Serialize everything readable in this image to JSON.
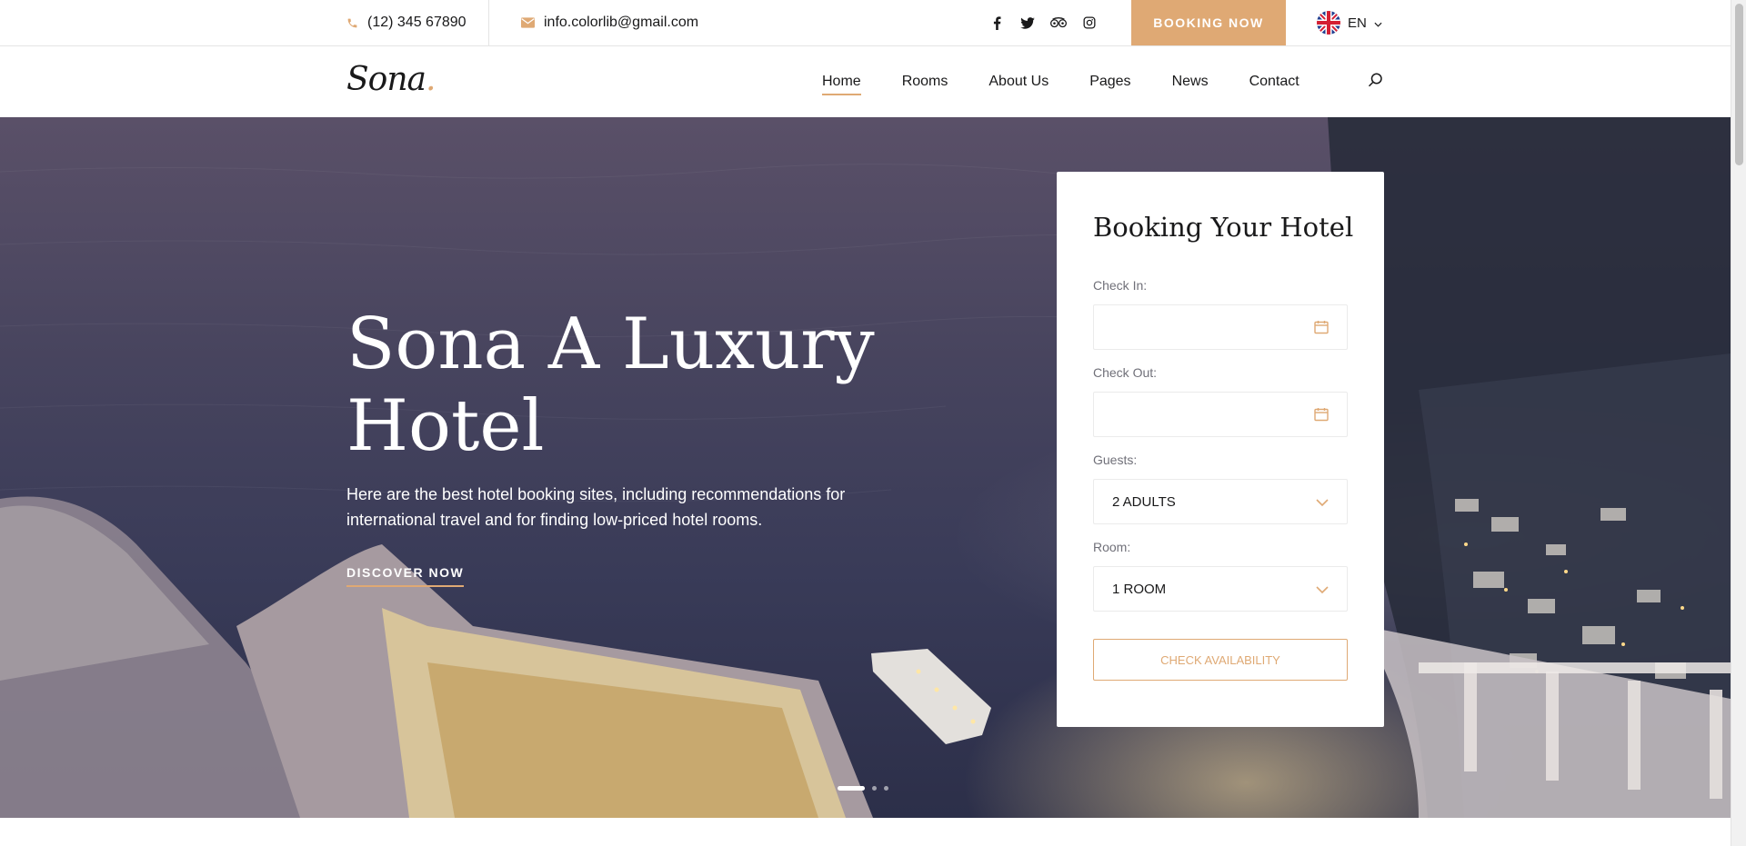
{
  "topbar": {
    "phone": "(12) 345 67890",
    "email": "info.colorlib@gmail.com",
    "social_icons": [
      "facebook-icon",
      "twitter-icon",
      "tripadvisor-icon",
      "instagram-icon"
    ],
    "booking_button": "Booking Now",
    "language": "EN"
  },
  "header": {
    "logo_text": "Sona",
    "logo_dot": ".",
    "nav": [
      {
        "label": "Home",
        "active": true
      },
      {
        "label": "Rooms"
      },
      {
        "label": "About Us"
      },
      {
        "label": "Pages"
      },
      {
        "label": "News"
      },
      {
        "label": "Contact"
      }
    ]
  },
  "hero": {
    "title": "Sona A Luxury Hotel",
    "text": "Here are the best hotel booking sites, including recommendations for international travel and for finding low-priced hotel rooms.",
    "cta": "Discover Now",
    "slides": 3,
    "active_slide": 1
  },
  "booking": {
    "title": "Booking Your Hotel",
    "check_in_label": "Check In:",
    "check_in_value": "",
    "check_out_label": "Check Out:",
    "check_out_value": "",
    "guests_label": "Guests:",
    "guests_value": "2 Adults",
    "room_label": "Room:",
    "room_value": "1 Room",
    "submit": "Check Availability"
  },
  "colors": {
    "accent": "#dfa974",
    "text": "#19191a",
    "muted": "#707079"
  }
}
